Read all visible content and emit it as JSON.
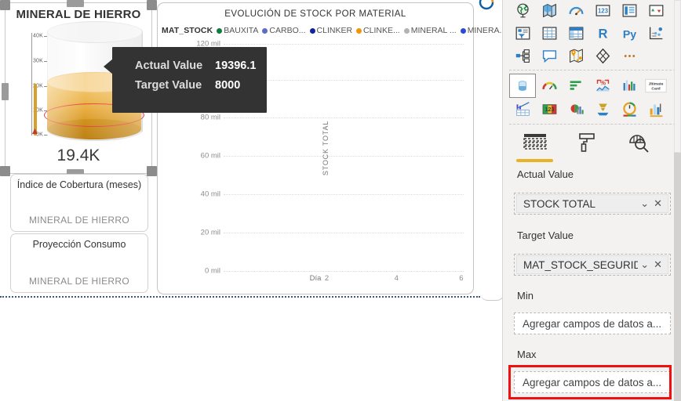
{
  "gauge_visual": {
    "title": "MINERAL DE HIERRO",
    "display_value": "19.4K",
    "axis_ticks": [
      "40K",
      "30K",
      "20K",
      "10K",
      "0K"
    ],
    "actual_value": 19396.1,
    "target_value": 8000,
    "axis_max": 40000
  },
  "tooltip": {
    "rows": [
      {
        "label": "Actual Value",
        "value": "19396.1"
      },
      {
        "label": "Target Value",
        "value": "8000"
      }
    ]
  },
  "mini_cards": [
    {
      "title": "Índice de Cobertura (meses)",
      "category": "MINERAL DE HIERRO"
    },
    {
      "title": "Proyección Consumo",
      "category": "MINERAL DE HIERRO"
    }
  ],
  "line_visual": {
    "title": "EVOLUCIÓN DE STOCK POR MATERIAL",
    "legend_name": "MAT_STOCK",
    "legend": [
      {
        "label": "BAUXITA",
        "color": "#107c41"
      },
      {
        "label": "CARBO...",
        "color": "#5b6ec4"
      },
      {
        "label": "CLINKER",
        "color": "#12239e"
      },
      {
        "label": "CLINKE...",
        "color": "#f2950b"
      },
      {
        "label": "MINERAL ...",
        "color": "#b3b3b3"
      },
      {
        "label": "MINERA...",
        "color": "#2b4ad6"
      }
    ]
  },
  "chart_data": {
    "type": "line",
    "title": "EVOLUCIÓN DE STOCK POR MATERIAL",
    "xlabel": "Día",
    "ylabel": "STOCK TOTAL",
    "grid": true,
    "legend_position": "top",
    "legend_title": "MAT_STOCK",
    "x_ticks": [
      "2",
      "4",
      "6"
    ],
    "xlim": [
      1,
      6.4
    ],
    "y_ticks": [
      "0 mil",
      "20 mil",
      "40 mil",
      "60 mil",
      "80 mil",
      "120 mil"
    ],
    "y_tick_values": [
      0,
      20000,
      40000,
      60000,
      80000,
      120000
    ],
    "ylim": [
      0,
      120000
    ],
    "series": [
      {
        "name": "BAUXITA",
        "color": "#107c41",
        "x": [],
        "values": []
      },
      {
        "name": "CARBO...",
        "color": "#5b6ec4",
        "x": [],
        "values": []
      },
      {
        "name": "CLINKER",
        "color": "#12239e",
        "x": [],
        "values": []
      },
      {
        "name": "CLINKE...",
        "color": "#f2950b",
        "x": [],
        "values": []
      },
      {
        "name": "MINERAL ...",
        "color": "#b3b3b3",
        "x": [],
        "values": []
      },
      {
        "name": "MINERA...",
        "color": "#2b4ad6",
        "x": [],
        "values": []
      }
    ]
  },
  "viz_pane": {
    "icons_row_1": [
      "map-icon",
      "filled-map-icon",
      "gauge-icon",
      "card-number-icon",
      "multi-row-card-icon",
      "kpi-icon"
    ],
    "icons_row_2": [
      "slicer-icon",
      "table-icon",
      "matrix-icon",
      "r-script-icon",
      "python-script-icon",
      "key-influencers-icon"
    ],
    "icons_row_3": [
      "decomposition-tree-icon",
      "q-and-a-icon",
      "arcgis-map-icon",
      "power-apps-icon",
      "more-options-icon"
    ],
    "icons_row_4": [
      "cylinder-gauge-icon",
      "radial-gauge-icon",
      "bullet-chart-icon",
      "kpi-percent-icon",
      "column-sparkline-icon",
      "ultimate-card-icon"
    ],
    "icons_row_5": [
      "combo-chart-icon",
      "number-card-icon",
      "custom-visual-icon",
      "tornado-icon",
      "dial-gauge-icon",
      "bar-chart-icon"
    ],
    "icons_row_6": [
      "fields-icon",
      "format-paintroller-icon",
      "analytics-magnifier-icon"
    ],
    "fields": [
      {
        "label": "Actual Value",
        "value": "STOCK TOTAL",
        "filled": true,
        "highlighted": false
      },
      {
        "label": "Target Value",
        "value": "MAT_STOCK_SEGURIDAD",
        "filled": true,
        "highlighted": false
      },
      {
        "label": "Min",
        "value": "Agregar campos de datos a...",
        "filled": false,
        "highlighted": false
      },
      {
        "label": "Max",
        "value": "Agregar campos de datos a...",
        "filled": false,
        "highlighted": true
      }
    ],
    "highlight_color": "#ee1111"
  }
}
